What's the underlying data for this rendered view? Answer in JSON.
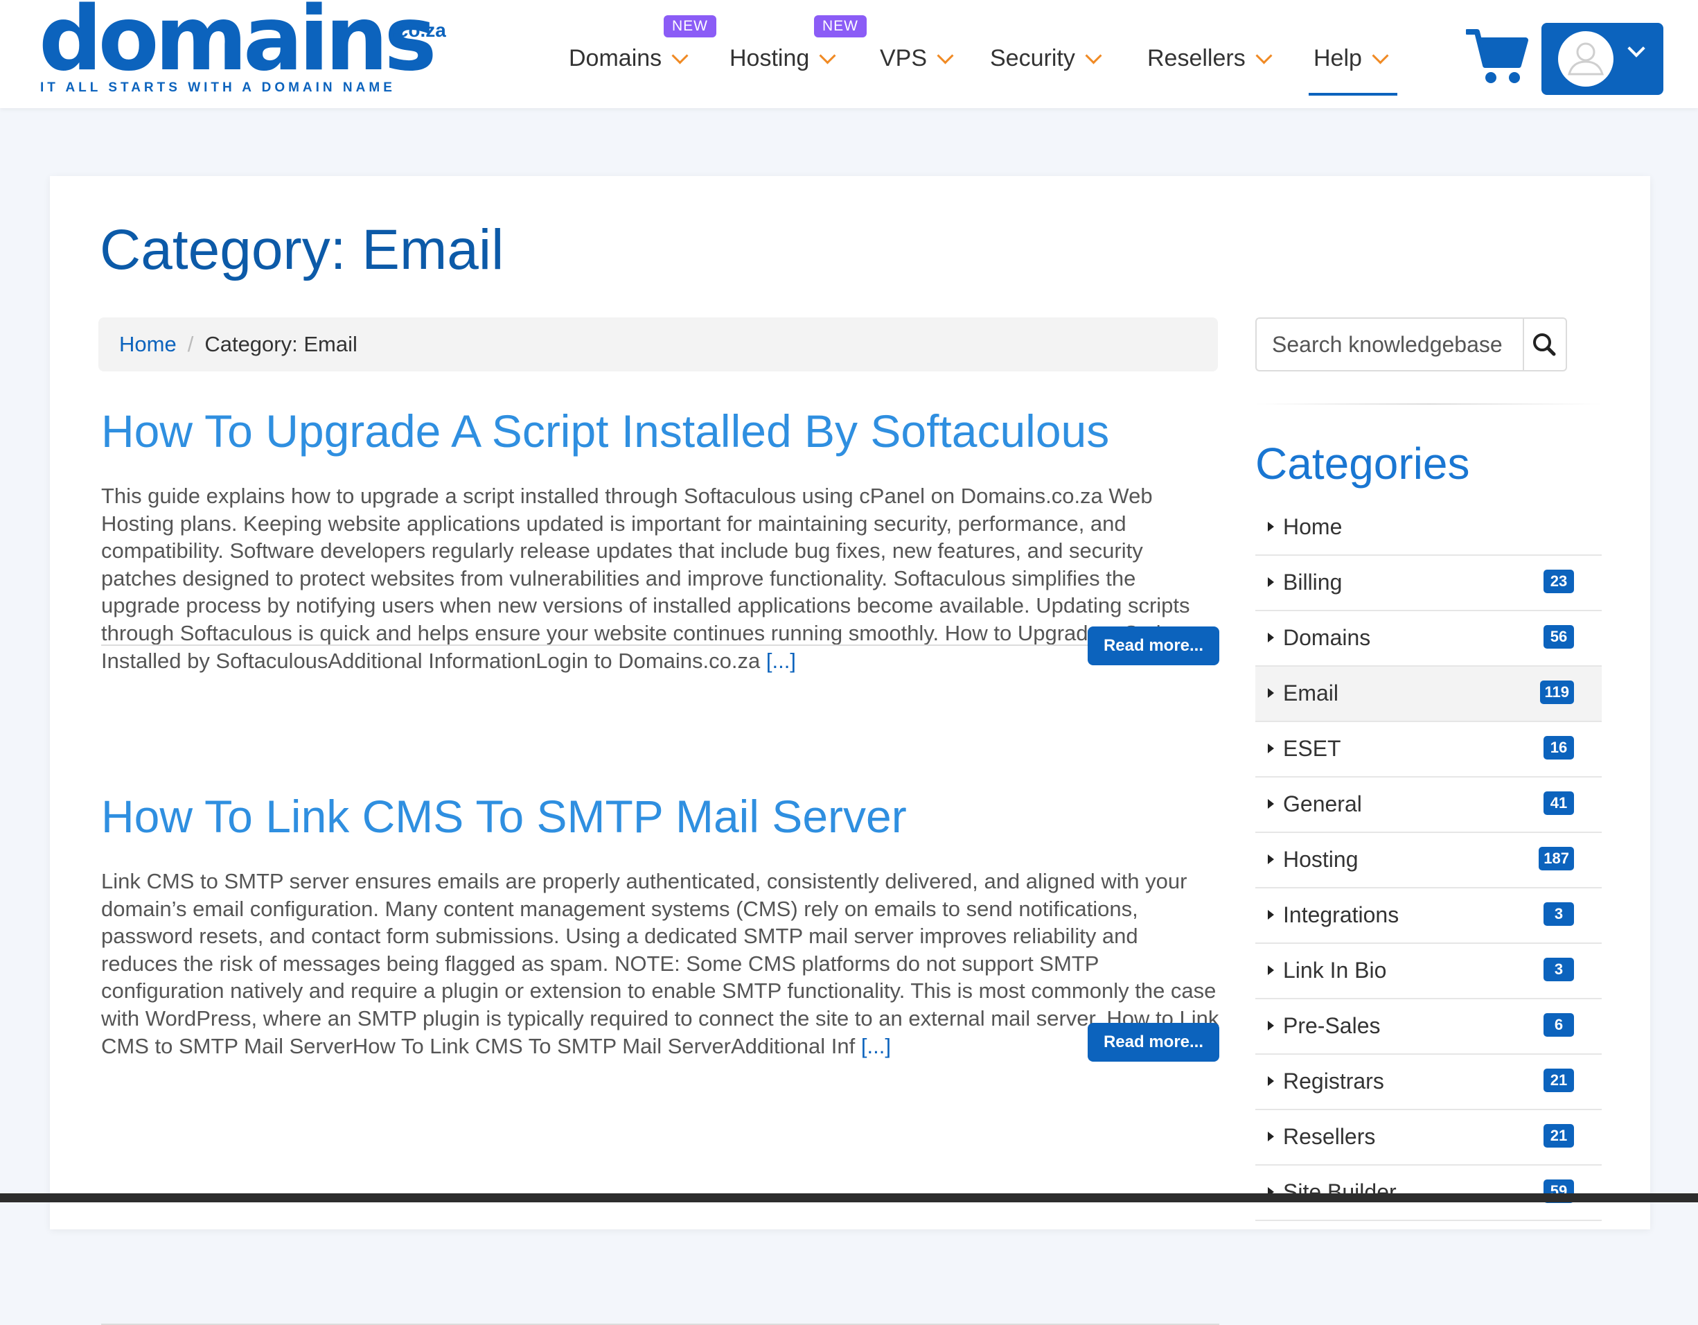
{
  "brand": {
    "logo_word": "domains",
    "logo_tld": ".co.za",
    "tagline": "IT ALL STARTS WITH A DOMAIN NAME",
    "primary_color": "#0c63bd",
    "badge_color": "#8b5cf6",
    "chevron_color": "#f08a24"
  },
  "nav": {
    "items": [
      {
        "label": "Domains",
        "badge": "NEW"
      },
      {
        "label": "Hosting",
        "badge": "NEW"
      },
      {
        "label": "VPS"
      },
      {
        "label": "Security"
      },
      {
        "label": "Resellers"
      },
      {
        "label": "Help",
        "active": true
      }
    ],
    "cart_icon": "cart-icon",
    "account_icon": "user-icon"
  },
  "page": {
    "title": "Category: Email",
    "breadcrumb": {
      "home": "Home",
      "separator": "/",
      "current": "Category: Email"
    }
  },
  "articles": [
    {
      "title": "How To Upgrade A Script Installed By Softaculous",
      "excerpt": "This guide explains how to upgrade a script installed through Softaculous using cPanel on Domains.co.za Web Hosting plans. Keeping website applications updated is important for maintaining security, performance, and compatibility. Software developers regularly release updates that include bug fixes, new features, and security patches designed to protect websites from vulnerabilities and improve functionality. Softaculous simplifies the upgrade process by notifying users when new versions of installed applications become available. Updating scripts through Softaculous is quick and helps ensure your website continues running smoothly. How to Upgrade a Script Installed by SoftaculousAdditional InformationLogin to Domains.co.za",
      "more": "[...]",
      "read_more": "Read more..."
    },
    {
      "title": "How To Link CMS To SMTP Mail Server",
      "excerpt": "Link CMS to SMTP server ensures emails are properly authenticated, consistently delivered, and aligned with your domain’s email configuration. Many content management systems (CMS) rely on emails to send notifications, password resets, and contact form submissions. Using a dedicated SMTP mail server improves reliability and reduces the risk of messages being flagged as spam. NOTE: Some CMS platforms do not support SMTP configuration natively and require a plugin or extension to enable SMTP functionality. This is most commonly the case with WordPress, where an SMTP plugin is typically required to connect the site to an external mail server. How to Link CMS to SMTP Mail ServerHow To Link CMS To SMTP Mail ServerAdditional Inf",
      "more": "[...]",
      "read_more": "Read more..."
    }
  ],
  "sidebar": {
    "search_placeholder": "Search knowledgebase",
    "categories_title": "Categories",
    "categories": [
      {
        "label": "Home",
        "count": ""
      },
      {
        "label": "Billing",
        "count": "23"
      },
      {
        "label": "Domains",
        "count": "56"
      },
      {
        "label": "Email",
        "count": "119",
        "active": true
      },
      {
        "label": "ESET",
        "count": "16"
      },
      {
        "label": "General",
        "count": "41"
      },
      {
        "label": "Hosting",
        "count": "187"
      },
      {
        "label": "Integrations",
        "count": "3"
      },
      {
        "label": "Link In Bio",
        "count": "3"
      },
      {
        "label": "Pre-Sales",
        "count": "6"
      },
      {
        "label": "Registrars",
        "count": "21"
      },
      {
        "label": "Resellers",
        "count": "21"
      },
      {
        "label": "Site Builder",
        "count": "59"
      }
    ]
  }
}
